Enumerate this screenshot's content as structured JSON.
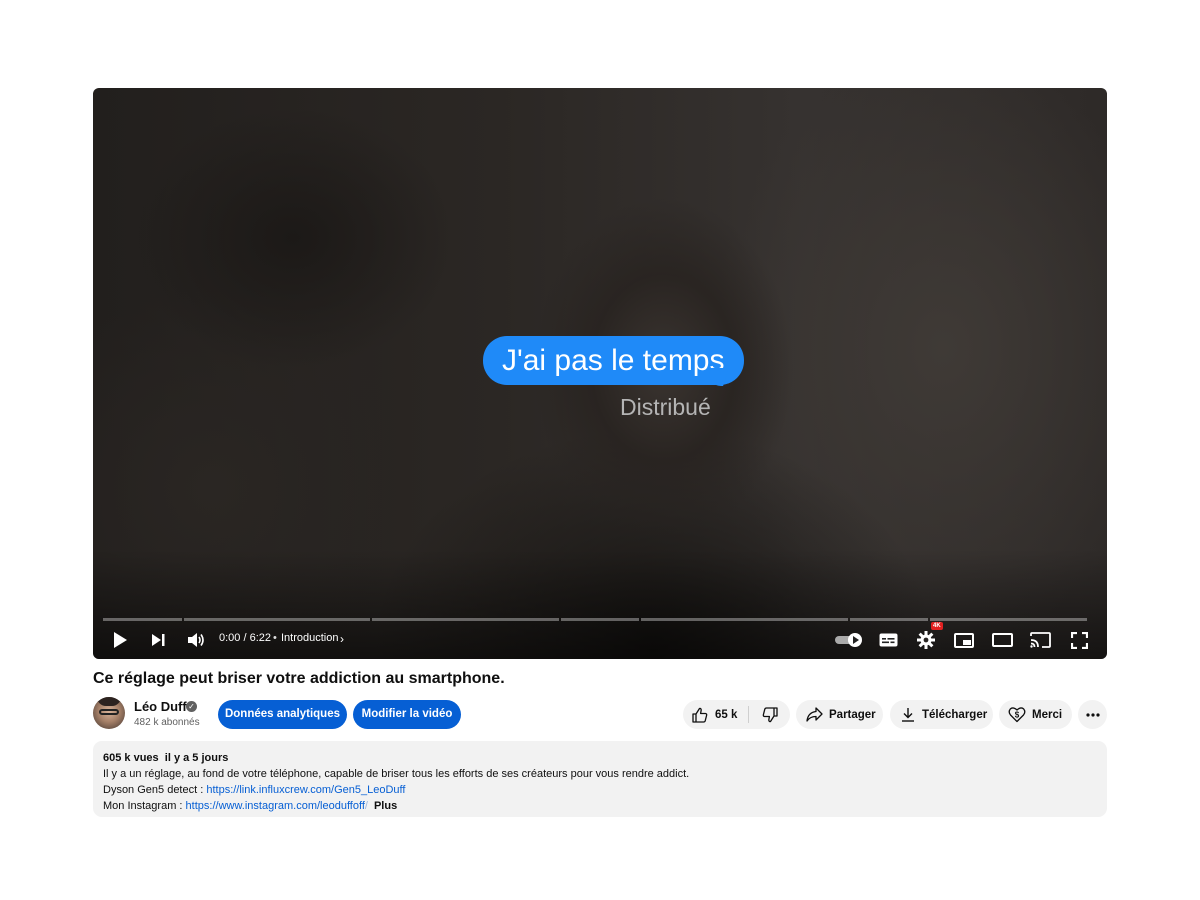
{
  "player": {
    "overlay_message": "J'ai pas le temps",
    "overlay_status": "Distribué",
    "time": "0:00 / 6:22",
    "chapter": "Introduction",
    "progress_segments": [
      0.08,
      0.19,
      0.19,
      0.08,
      0.21,
      0.08,
      0.16
    ],
    "played_fraction": 0.08,
    "hd_badge": "4K"
  },
  "video": {
    "title": "Ce réglage peut briser votre addiction au smartphone."
  },
  "channel": {
    "name": "Léo Duff",
    "subscribers": "482 k abonnés"
  },
  "actions": {
    "analytics": "Données analytiques",
    "edit_video": "Modifier la vidéo",
    "likes": "65 k",
    "share": "Partager",
    "download": "Télécharger",
    "thanks": "Merci"
  },
  "description": {
    "views": "605 k vues",
    "date": "il y a 5 jours",
    "line1": "Il y a un réglage, au fond de votre téléphone, capable de briser tous les efforts de ses créateurs pour vous rendre addict.",
    "sponsor_label": "Dyson Gen5 detect : ",
    "sponsor_link": "https://link.influxcrew.com/Gen5_LeoDuff",
    "instagram_label": "Mon Instagram : ",
    "instagram_link": "https://www.instagram.com/leoduffoff",
    "instagram_fade": "/",
    "more": "Plus"
  },
  "icons": [
    "play-icon",
    "next-icon",
    "volume-icon",
    "autoplay-toggle",
    "subtitles-icon",
    "settings-icon",
    "miniplayer-icon",
    "theater-icon",
    "cast-icon",
    "fullscreen-icon",
    "like-icon",
    "dislike-icon",
    "share-icon",
    "download-icon",
    "thanks-icon",
    "more-icon",
    "verified-icon"
  ]
}
